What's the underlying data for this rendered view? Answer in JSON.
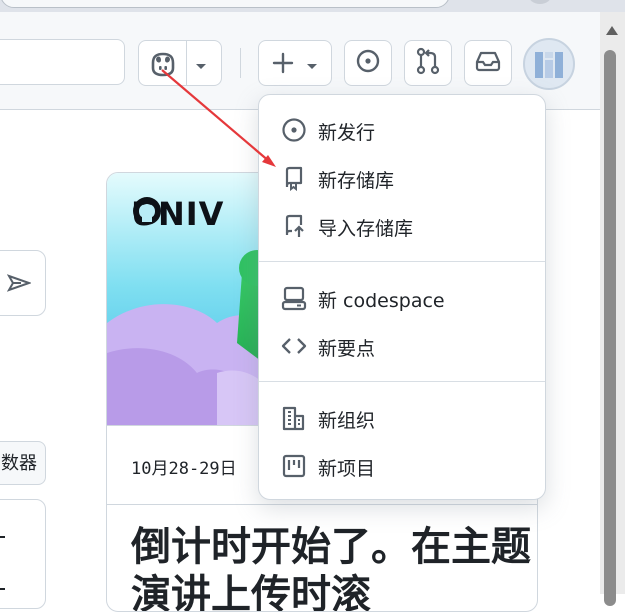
{
  "header": {
    "copilot_label": "Copilot",
    "create_label": "+",
    "issues_label": "Issues",
    "pulls_label": "Pull requests",
    "inbox_label": "Inbox"
  },
  "left": {
    "button_text": "数器"
  },
  "card": {
    "brand": "UNIV",
    "date": "10月28-29日",
    "headline": "倒计时开始了。在主题演讲上传时滚"
  },
  "menu": {
    "items": [
      {
        "label": "新发行",
        "icon": "tag-icon"
      },
      {
        "label": "新存储库",
        "icon": "repo-icon"
      },
      {
        "label": "导入存储库",
        "icon": "repo-push-icon"
      },
      {
        "label": "新 codespace",
        "icon": "codespaces-icon"
      },
      {
        "label": "新要点",
        "icon": "code-icon"
      },
      {
        "label": "新组织",
        "icon": "organization-icon"
      },
      {
        "label": "新项目",
        "icon": "project-icon"
      }
    ]
  },
  "colors": {
    "accent": "#0969da",
    "annotation_arrow": "#e5383b",
    "border": "#d0d7de",
    "header_bg": "#f6f8fa"
  }
}
